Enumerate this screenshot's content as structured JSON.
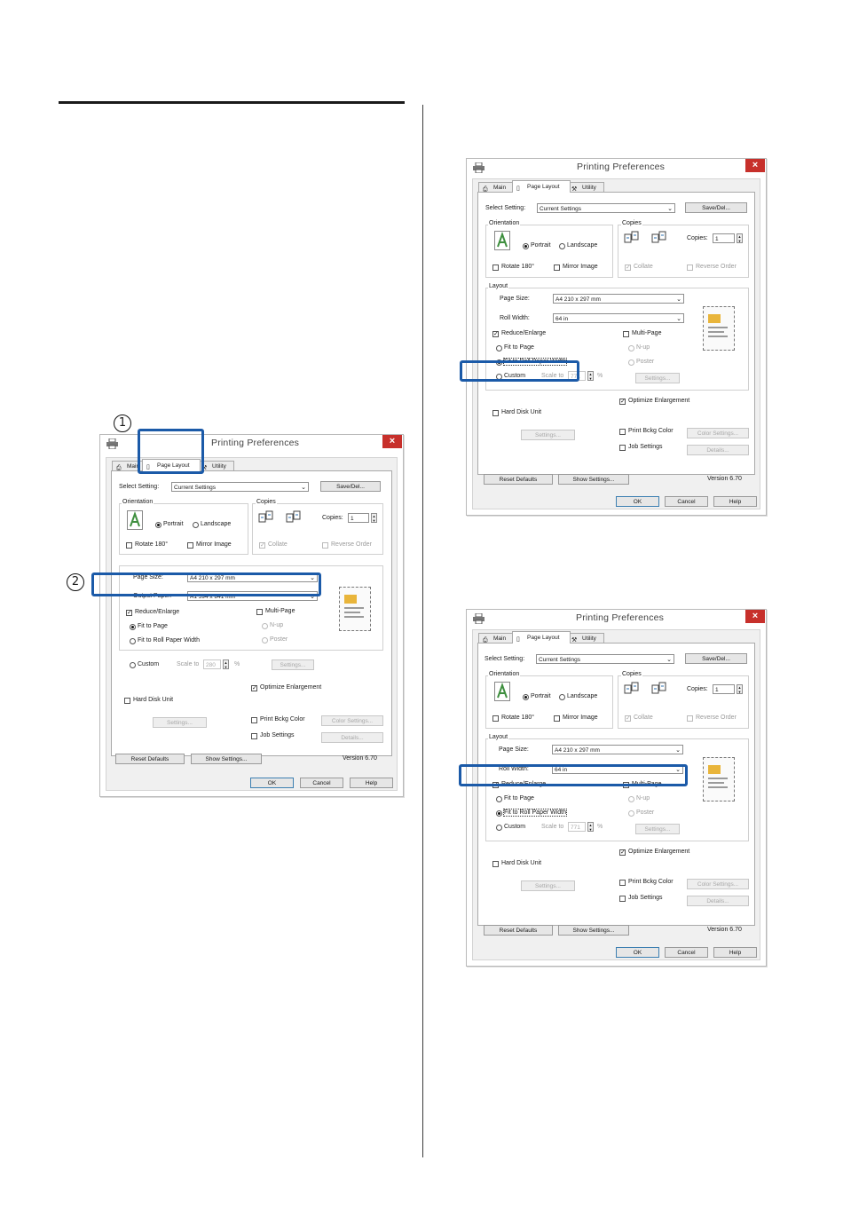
{
  "steps": {
    "one": "1",
    "two": "2"
  },
  "dialog": {
    "title": "Printing Preferences",
    "close": "×",
    "tabs": {
      "main": "Main",
      "page_layout": "Page Layout",
      "utility": "Utility"
    },
    "select_setting_label": "Select Setting:",
    "select_setting_value": "Current Settings",
    "save_del": "Save/Del...",
    "orientation_label": "Orientation",
    "portrait": "Portrait",
    "landscape": "Landscape",
    "rotate180": "Rotate 180°",
    "mirror_image": "Mirror Image",
    "copies_group": "Copies",
    "copies_label": "Copies:",
    "copies_value": "1",
    "collate": "Collate",
    "reverse_order": "Reverse Order",
    "layout_label": "Layout",
    "page_size_label": "Page Size:",
    "page_size_value": "A4 210 x 297 mm",
    "output_paper_label": "Output Paper:",
    "output_paper_value": "A1 594 x 841 mm",
    "roll_width_label": "Roll Width:",
    "roll_width_value": "64 in",
    "reduce_enlarge": "Reduce/Enlarge",
    "fit_to_page": "Fit to Page",
    "fit_to_roll": "Fit to Roll Paper Width",
    "custom": "Custom",
    "scale_to": "Scale to",
    "scale_value_1": "280",
    "scale_value_2": "771",
    "percent": "%",
    "multi_page": "Multi-Page",
    "n_up": "N-up",
    "poster": "Poster",
    "settings": "Settings...",
    "optimize_enlargement": "Optimize Enlargement",
    "hard_disk_unit": "Hard Disk Unit",
    "print_bckg_color": "Print Bckg Color",
    "color_settings": "Color Settings...",
    "job_settings": "Job Settings",
    "details": "Details...",
    "reset_defaults": "Reset Defaults",
    "show_settings": "Show Settings...",
    "version": "Version 6.70",
    "ok": "OK",
    "cancel": "Cancel",
    "help": "Help",
    "check_mark": "✓"
  },
  "colors": {
    "highlight": "#1b5aa8",
    "close": "#c7302b"
  }
}
